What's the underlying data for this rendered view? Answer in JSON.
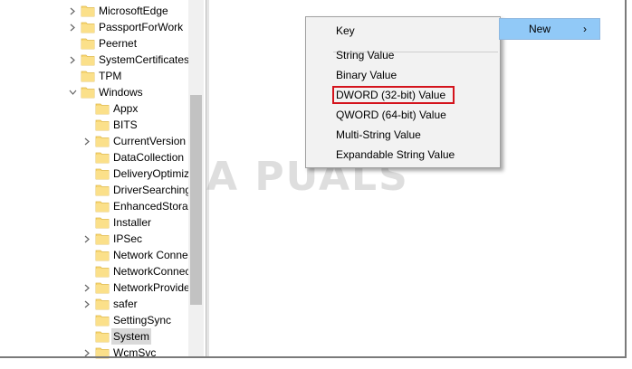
{
  "tree": {
    "items": [
      {
        "label": "MicrosoftEdge",
        "level": 1,
        "expandable": true,
        "expanded": false
      },
      {
        "label": "PassportForWork",
        "level": 1,
        "expandable": true,
        "expanded": false
      },
      {
        "label": "Peernet",
        "level": 1,
        "expandable": false,
        "expanded": false
      },
      {
        "label": "SystemCertificates",
        "level": 1,
        "expandable": true,
        "expanded": false
      },
      {
        "label": "TPM",
        "level": 1,
        "expandable": false,
        "expanded": false
      },
      {
        "label": "Windows",
        "level": 1,
        "expandable": true,
        "expanded": true
      },
      {
        "label": "Appx",
        "level": 2,
        "expandable": false,
        "expanded": false
      },
      {
        "label": "BITS",
        "level": 2,
        "expandable": false,
        "expanded": false
      },
      {
        "label": "CurrentVersion",
        "level": 2,
        "expandable": true,
        "expanded": false
      },
      {
        "label": "DataCollection",
        "level": 2,
        "expandable": false,
        "expanded": false
      },
      {
        "label": "DeliveryOptimiz",
        "level": 2,
        "expandable": false,
        "expanded": false
      },
      {
        "label": "DriverSearching",
        "level": 2,
        "expandable": false,
        "expanded": false
      },
      {
        "label": "EnhancedStorag",
        "level": 2,
        "expandable": false,
        "expanded": false
      },
      {
        "label": "Installer",
        "level": 2,
        "expandable": false,
        "expanded": false
      },
      {
        "label": "IPSec",
        "level": 2,
        "expandable": true,
        "expanded": false
      },
      {
        "label": "Network Conne",
        "level": 2,
        "expandable": false,
        "expanded": false
      },
      {
        "label": "NetworkConnec",
        "level": 2,
        "expandable": false,
        "expanded": false
      },
      {
        "label": "NetworkProvide",
        "level": 2,
        "expandable": true,
        "expanded": false
      },
      {
        "label": "safer",
        "level": 2,
        "expandable": true,
        "expanded": false
      },
      {
        "label": "SettingSync",
        "level": 2,
        "expandable": false,
        "expanded": false
      },
      {
        "label": "System",
        "level": 2,
        "expandable": false,
        "expanded": false,
        "selected": true
      },
      {
        "label": "WcmSvc",
        "level": 2,
        "expandable": true,
        "expanded": false
      }
    ]
  },
  "context_menu": {
    "items": [
      {
        "label": "Key"
      },
      {
        "label": "String Value"
      },
      {
        "label": "Binary Value"
      },
      {
        "label": "DWORD (32-bit) Value",
        "highlighted": true
      },
      {
        "label": "QWORD (64-bit) Value"
      },
      {
        "label": "Multi-String Value"
      },
      {
        "label": "Expandable String Value"
      }
    ]
  },
  "parent_menu": {
    "label": "New",
    "arrow": "›"
  },
  "colors": {
    "highlight_box": "#d4131c",
    "menu_hover": "#91c9f7",
    "folder": "#f5d36b"
  },
  "icons": {
    "folder": "folder-icon",
    "chevron_right": "chevron-right-icon",
    "chevron_down": "chevron-down-icon"
  }
}
